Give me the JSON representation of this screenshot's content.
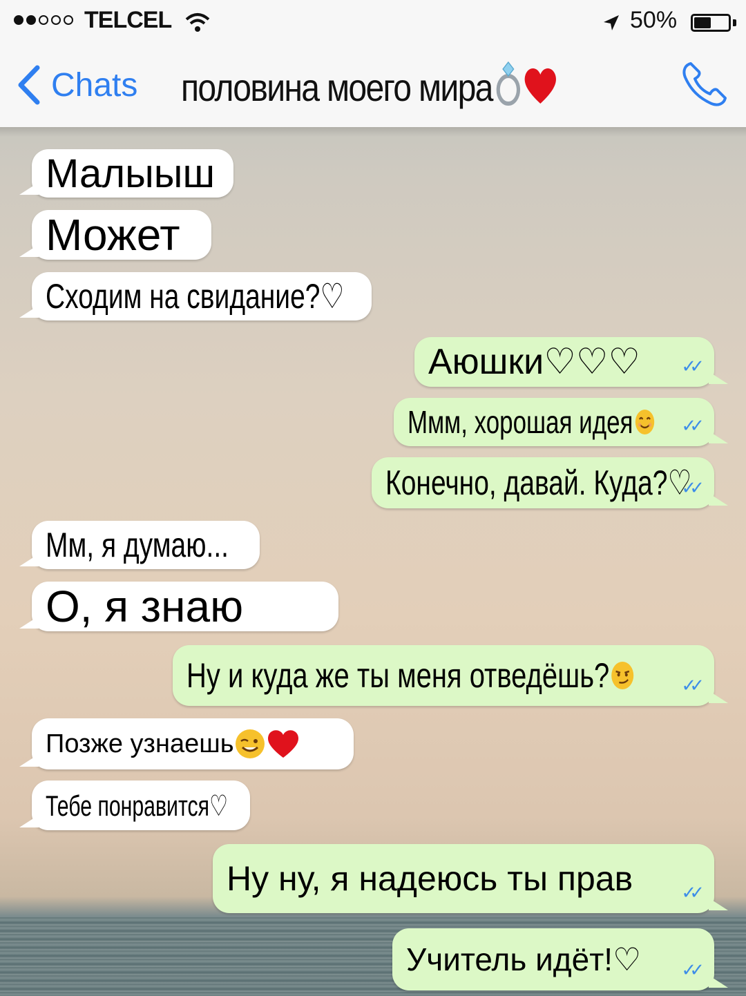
{
  "status_bar": {
    "carrier": "TELCEL",
    "battery": "50%",
    "battery_level": 0.5
  },
  "nav": {
    "back_label": "Chats",
    "title": "половина моего мира"
  },
  "messages": [
    {
      "direction": "in",
      "text": "Малыыш"
    },
    {
      "direction": "in",
      "text": "Может"
    },
    {
      "direction": "in",
      "text": "Сходим на свидание?♡"
    },
    {
      "direction": "out",
      "text": "Аюшки♡♡♡"
    },
    {
      "direction": "out",
      "text": "Ммм, хорошая идея"
    },
    {
      "direction": "out",
      "text": "Конечно, давай. Куда?♡"
    },
    {
      "direction": "in",
      "text": "Мм, я думаю..."
    },
    {
      "direction": "in",
      "text": "О, я знаю"
    },
    {
      "direction": "out",
      "text": "Ну и куда же ты меня отведёшь?"
    },
    {
      "direction": "in",
      "text": "Позже узнаешь"
    },
    {
      "direction": "in",
      "text": "Тебе понравится♡"
    },
    {
      "direction": "out",
      "text": "Ну ну, я надеюсь ты прав"
    },
    {
      "direction": "out",
      "text": "Учитель идёт!♡"
    }
  ],
  "colors": {
    "accent": "#2f7ff0",
    "outgoing_bubble": "#dcf8c6",
    "incoming_bubble": "#ffffff",
    "read_ticks": "#3d8de8"
  },
  "icons": [
    "back-chevron-icon",
    "phone-icon",
    "wifi-icon",
    "location-arrow-icon",
    "battery-icon",
    "ring-emoji-icon",
    "heart-emoji-icon",
    "smile-emoji-icon",
    "smirk-emoji-icon",
    "wink-emoji-icon",
    "double-check-icon"
  ]
}
